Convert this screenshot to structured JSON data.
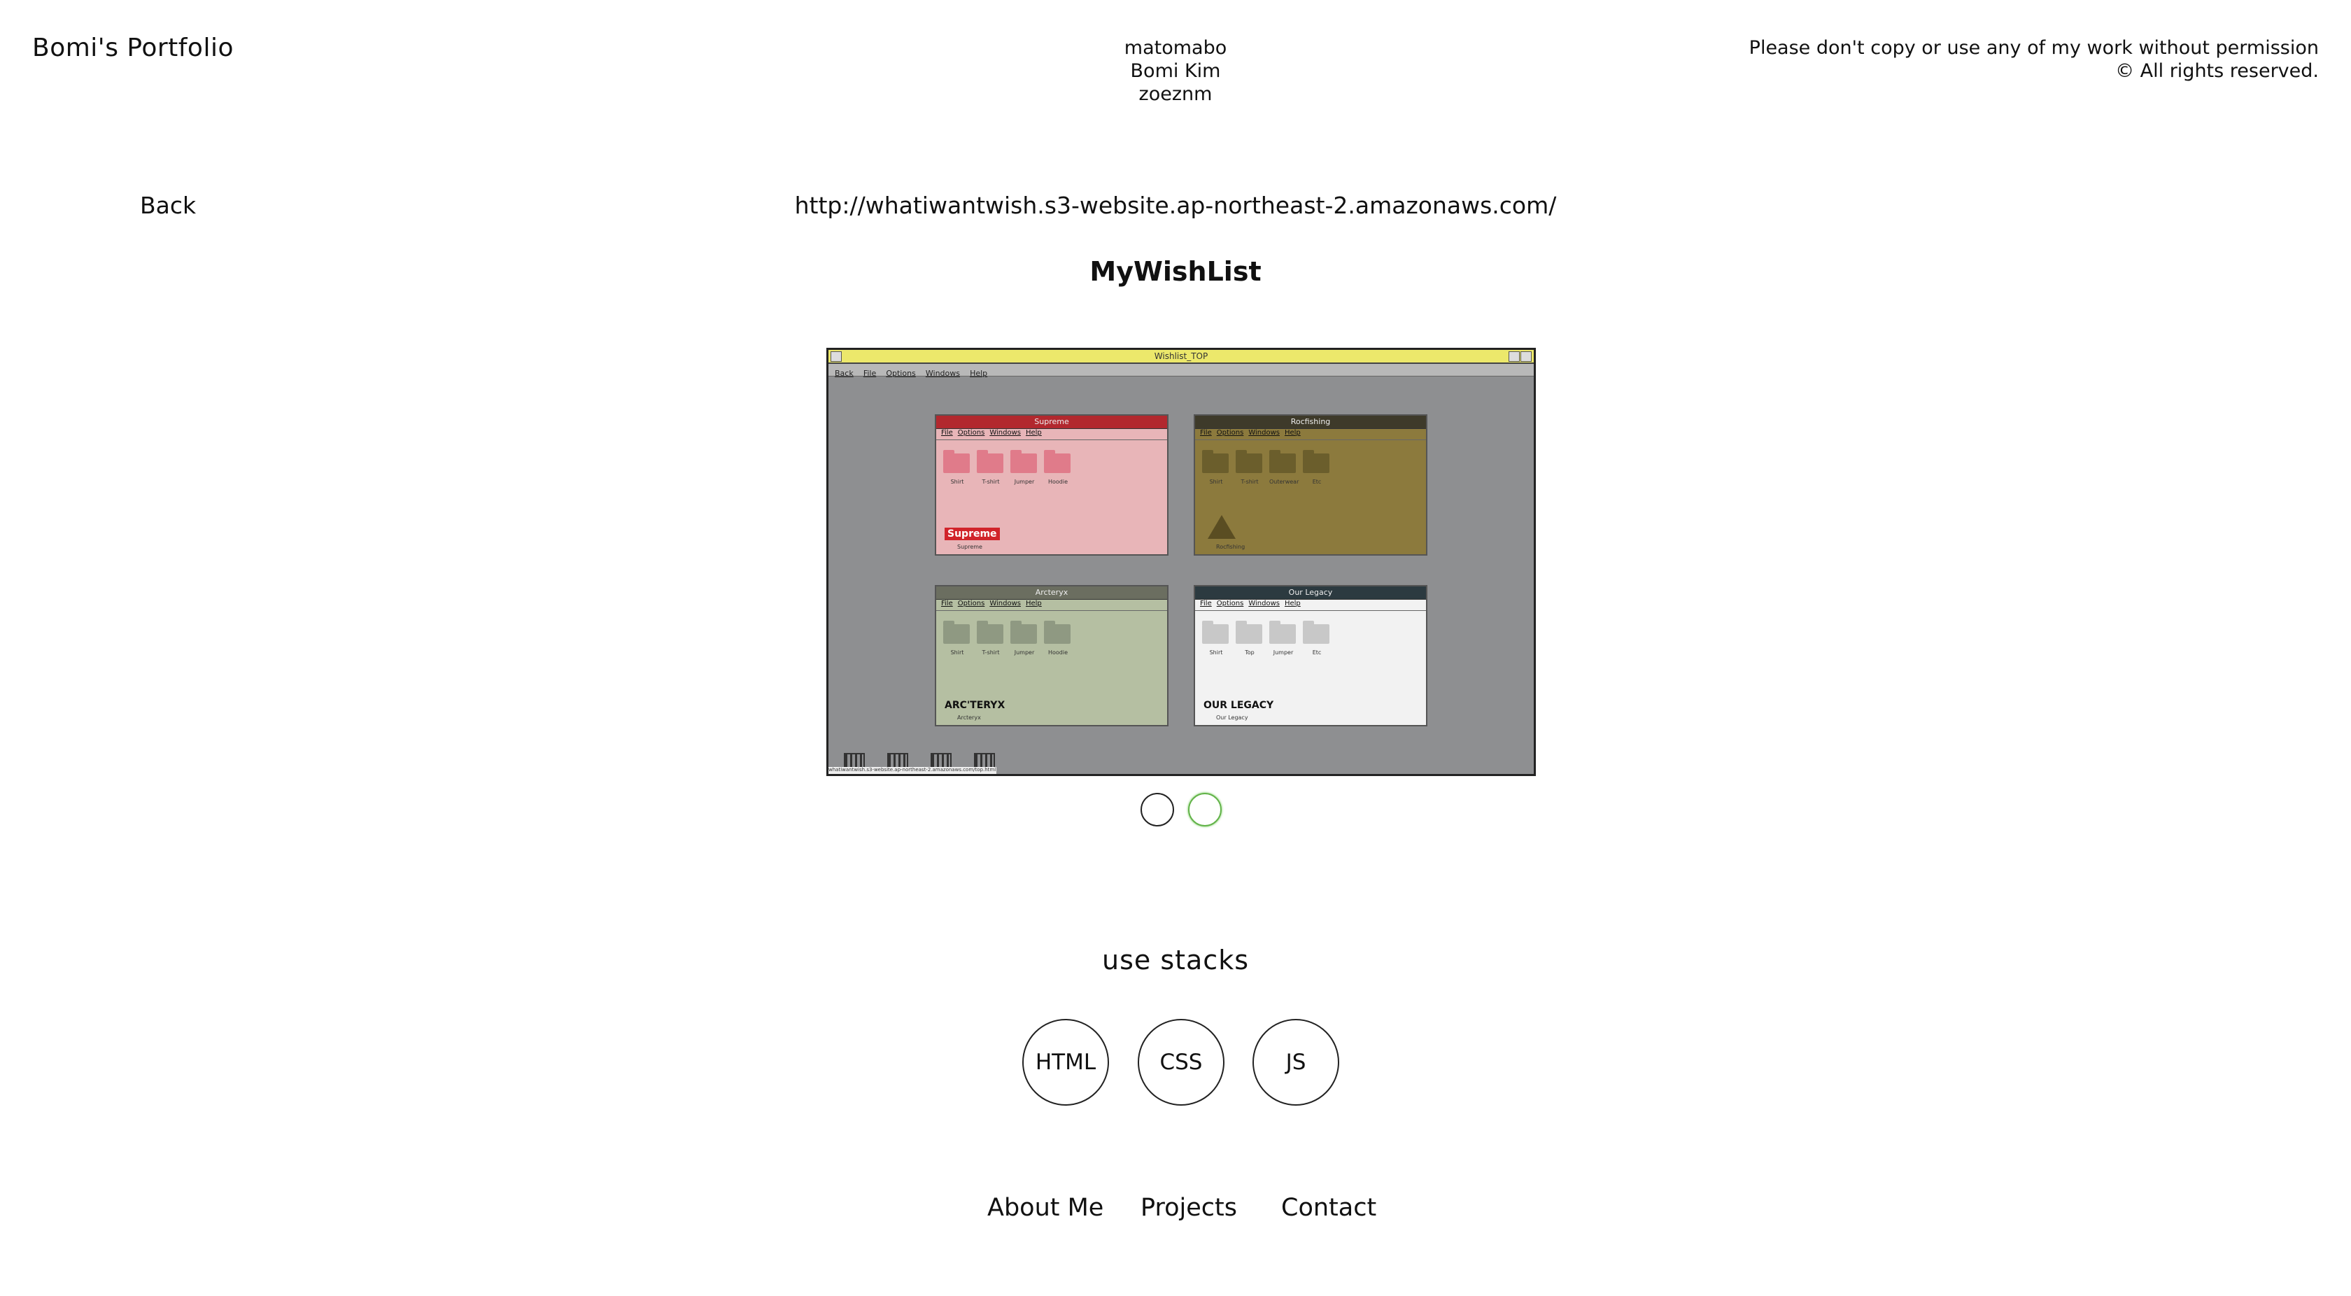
{
  "header": {
    "site_title": "Bomi's Portfolio",
    "credits": [
      "matomabo",
      "Bomi Kim",
      "zoeznm"
    ],
    "copyright_line1": "Please don't copy or use any of my work without permission",
    "copyright_line2": "© All rights reserved."
  },
  "project": {
    "back_label": "Back",
    "url": "http://whatiwantwish.s3-website.ap-northeast-2.amazonaws.com/",
    "title": "MyWishList"
  },
  "preview": {
    "window_title": "Wishlist_TOP",
    "menu": [
      "Back",
      "File",
      "Options",
      "Windows",
      "Help"
    ],
    "windows": [
      {
        "name": "Supreme",
        "bg": "#e8b5b8",
        "bar": "#b2282e",
        "folder": "#e07b8a",
        "folders": [
          "Shirt",
          "T-shirt",
          "Jumper",
          "Hoodie"
        ],
        "logo": "Supreme",
        "logo_sub": "Supreme"
      },
      {
        "name": "Rocfishing",
        "bg": "#8c7a3d",
        "bar": "#3e3a2a",
        "folder": "#6b5e2c",
        "folders": [
          "Shirt",
          "T-shirt",
          "Outerwear",
          "Etc"
        ],
        "logo": "",
        "logo_sub": "Rocfishing"
      },
      {
        "name": "Arcteryx",
        "bg": "#b5bfa2",
        "bar": "#6b6e60",
        "folder": "#8f9982",
        "folders": [
          "Shirt",
          "T-shirt",
          "Jumper",
          "Hoodie"
        ],
        "logo": "ARC'TERYX",
        "logo_sub": "Arcteryx"
      },
      {
        "name": "Our Legacy",
        "bg": "#f2f2f2",
        "bar": "#2c3a40",
        "folder": "#c8c8c8",
        "folders": [
          "Shirt",
          "Top",
          "Jumper",
          "Etc"
        ],
        "logo": "OUR LEGACY",
        "logo_sub": "Our Legacy"
      }
    ],
    "status_text": "whatiwantwish.s3-website.ap-northeast-2.amazonaws.com/top.html"
  },
  "carousel": {
    "slides": 2,
    "active": 2
  },
  "stacks": {
    "heading": "use stacks",
    "items": [
      "HTML",
      "CSS",
      "JS"
    ]
  },
  "footer": {
    "links": [
      "About Me",
      "Projects",
      "Contact"
    ]
  },
  "colors": {
    "accent_dot": "#63b34a"
  }
}
